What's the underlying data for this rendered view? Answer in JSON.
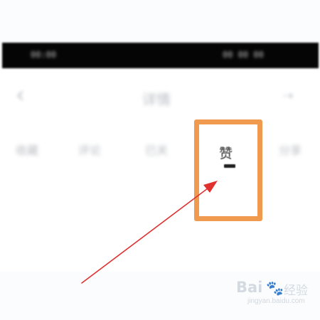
{
  "status_bar": {
    "left_text": "00:00",
    "right_text": "00 00 00"
  },
  "nav": {
    "back_icon": "chevron-left-icon",
    "back_glyph": "‹",
    "title": "详情",
    "more_icon": "share-icon",
    "more_glyph": "⇢"
  },
  "actions": [
    {
      "label": "收藏"
    },
    {
      "label": "评论"
    },
    {
      "label": "已关"
    },
    {
      "label": "赞",
      "count": "—",
      "highlighted": true
    },
    {
      "label": "分享"
    }
  ],
  "highlight": {
    "color": "#ef9a4e"
  },
  "annotation": {
    "arrow_color": "#e0312f"
  },
  "watermark": {
    "brand": "Bai",
    "brand_cn": "经验",
    "url": "jingyan.baidu.com"
  }
}
